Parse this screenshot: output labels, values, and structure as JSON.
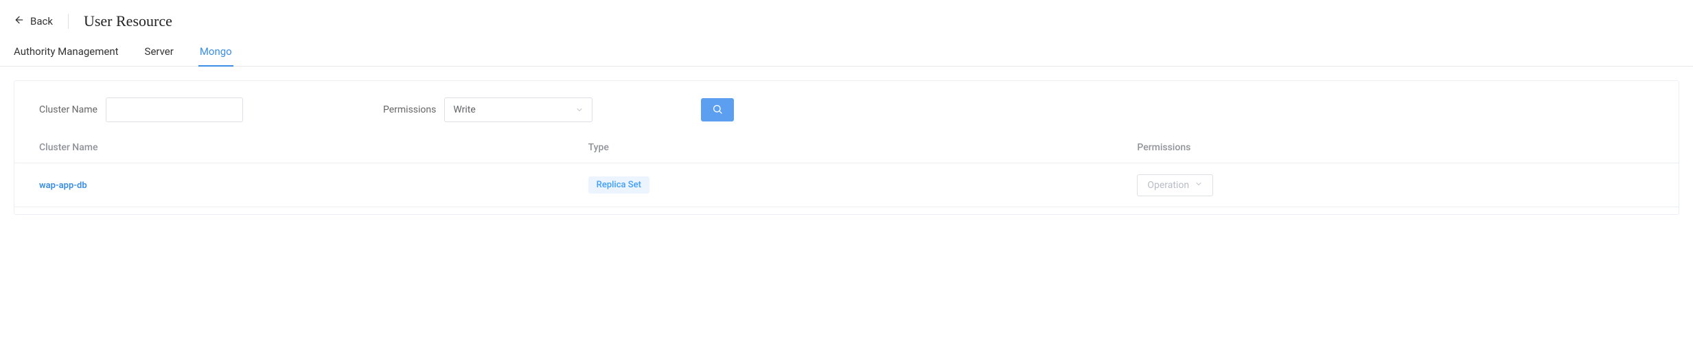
{
  "header": {
    "back_label": "Back",
    "title": "User Resource"
  },
  "tabs": [
    {
      "label": "Authority Management",
      "active": false
    },
    {
      "label": "Server",
      "active": false
    },
    {
      "label": "Mongo",
      "active": true
    }
  ],
  "filters": {
    "cluster_name_label": "Cluster Name",
    "cluster_name_value": "",
    "permissions_label": "Permissions",
    "permissions_value": "Write"
  },
  "table": {
    "columns": {
      "cluster_name": "Cluster Name",
      "type": "Type",
      "permissions": "Permissions"
    },
    "rows": [
      {
        "cluster_name": "wap-app-db",
        "type": "Replica Set",
        "operation_label": "Operation"
      }
    ]
  }
}
